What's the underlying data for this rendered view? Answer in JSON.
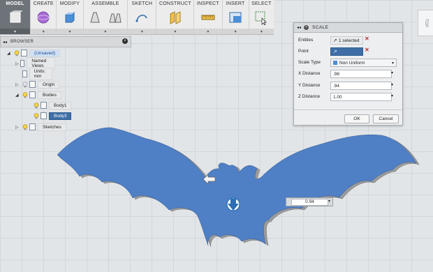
{
  "toolbar": {
    "groups": [
      {
        "label": "MODEL"
      },
      {
        "label": "CREATE"
      },
      {
        "label": "MODIFY"
      },
      {
        "label": "ASSEMBLE"
      },
      {
        "label": "SKETCH"
      },
      {
        "label": "CONSTRUCT"
      },
      {
        "label": "INSPECT"
      },
      {
        "label": "INSERT"
      },
      {
        "label": "SELECT"
      }
    ]
  },
  "viewcube": {
    "label": "TOP"
  },
  "browser": {
    "title": "BROWSER",
    "nodes": [
      {
        "label": "(Unsaved)"
      },
      {
        "label": "Named Views"
      },
      {
        "label": "Units: mm"
      },
      {
        "label": "Origin"
      },
      {
        "label": "Bodies"
      },
      {
        "label": "Body1"
      },
      {
        "label": "Body3"
      },
      {
        "label": "Sketches"
      }
    ]
  },
  "dialog": {
    "title": "SCALE",
    "entities_label": "Entities",
    "entities_value": "1 selected",
    "point_label": "Point",
    "scale_type_label": "Scale Type",
    "scale_type_value": "Non Uniform",
    "x_label": "X Distance",
    "x_value": ".98",
    "y_label": "Y Distance",
    "y_value": ".94",
    "z_label": "Z Distance",
    "z_value": "1.00",
    "ok": "OK",
    "cancel": "Cancel"
  },
  "viewport": {
    "value_input": "0.94",
    "colors": {
      "bat_fill": "#4f7fc4",
      "bat_edge": "#8a8a8a",
      "arrow": "#2a6fb5"
    }
  }
}
